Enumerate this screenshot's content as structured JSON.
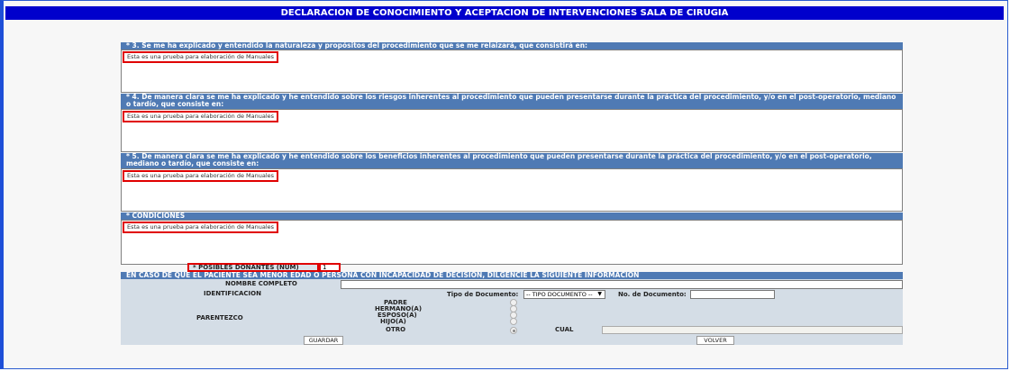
{
  "title": "DECLARACION DE CONOCIMIENTO Y ACEPTACION DE INTERVENCIONES SALA DE CIRUGIA",
  "sections": [
    {
      "header": "* 3. Se me ha explicado y entendido la naturaleza y propósitos del procedimiento que se me relaizará, que consistirá en:",
      "value": "Esta es una prueba para elaboración de Manuales"
    },
    {
      "header": "* 4. De manera clara se me ha explicado y he entendido sobre los riesgos inherentes al procedimiento que pueden presentarse durante la práctica del procedimiento, y/o en el post-operatorio, mediano o tardío, que consiste en:",
      "value": "Esta es una prueba para elaboración de Manuales"
    },
    {
      "header": "* 5. De manera clara se me ha explicado y he entendido sobre los beneficios inherentes al procedimiento que pueden presentarse durante la práctica del procedimiento, y/o en el post-operatorio, mediano o tardío, que consiste en:",
      "value": "Esta es una prueba para elaboración de Manuales"
    },
    {
      "header": "* CONDICIONES",
      "value": "Esta es una prueba para elaboración de Manuales"
    }
  ],
  "donantes": {
    "label": "* POSIBLES DONANTES (NUM)",
    "value": "1"
  },
  "menor": {
    "header": "EN CASO DE QUE EL PACIENTE SEA MENOR EDAD O PERSONA CON INCAPACIDAD DE DECISION, DILGENCIE LA SIGUIENTE INFORMACION",
    "nombre_label": "NOMBRE COMPLETO",
    "identificacion_label": "IDENTIFICACION",
    "tipo_doc_label": "Tipo de Documento:",
    "tipo_doc_value": "-- TIPO DOCUMENTO --",
    "no_doc_label": "No. de Documento:",
    "parentezco_label": "PARENTEZCO",
    "options": [
      "PADRE",
      "HERMANO(A)",
      "ESPOSO(A)",
      "HIJO(A)",
      "OTRO"
    ],
    "selected_option": "OTRO",
    "cual_label": "CUAL"
  },
  "buttons": {
    "guardar": "GUARDAR",
    "volver": "VOLVER"
  },
  "colors": {
    "title_bg": "#0000cc",
    "section_header_bg": "#4f7ab4",
    "highlight": "#e00000"
  }
}
